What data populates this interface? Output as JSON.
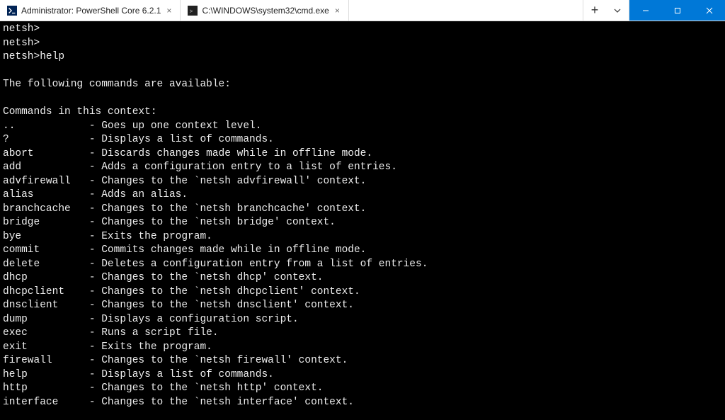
{
  "tabs": [
    {
      "label": "Administrator: PowerShell Core 6.2.1"
    },
    {
      "label": "C:\\WINDOWS\\system32\\cmd.exe"
    }
  ],
  "prompt_lines": [
    "netsh>",
    "netsh>",
    "netsh>help"
  ],
  "header1": "The following commands are available:",
  "header2": "Commands in this context:",
  "commands": [
    {
      "name": "..",
      "desc": "- Goes up one context level."
    },
    {
      "name": "?",
      "desc": "- Displays a list of commands."
    },
    {
      "name": "abort",
      "desc": "- Discards changes made while in offline mode."
    },
    {
      "name": "add",
      "desc": "- Adds a configuration entry to a list of entries."
    },
    {
      "name": "advfirewall",
      "desc": "- Changes to the `netsh advfirewall' context."
    },
    {
      "name": "alias",
      "desc": "- Adds an alias."
    },
    {
      "name": "branchcache",
      "desc": "- Changes to the `netsh branchcache' context."
    },
    {
      "name": "bridge",
      "desc": "- Changes to the `netsh bridge' context."
    },
    {
      "name": "bye",
      "desc": "- Exits the program."
    },
    {
      "name": "commit",
      "desc": "- Commits changes made while in offline mode."
    },
    {
      "name": "delete",
      "desc": "- Deletes a configuration entry from a list of entries."
    },
    {
      "name": "dhcp",
      "desc": "- Changes to the `netsh dhcp' context."
    },
    {
      "name": "dhcpclient",
      "desc": "- Changes to the `netsh dhcpclient' context."
    },
    {
      "name": "dnsclient",
      "desc": "- Changes to the `netsh dnsclient' context."
    },
    {
      "name": "dump",
      "desc": "- Displays a configuration script."
    },
    {
      "name": "exec",
      "desc": "- Runs a script file."
    },
    {
      "name": "exit",
      "desc": "- Exits the program."
    },
    {
      "name": "firewall",
      "desc": "- Changes to the `netsh firewall' context."
    },
    {
      "name": "help",
      "desc": "- Displays a list of commands."
    },
    {
      "name": "http",
      "desc": "- Changes to the `netsh http' context."
    },
    {
      "name": "interface",
      "desc": "- Changes to the `netsh interface' context."
    }
  ]
}
